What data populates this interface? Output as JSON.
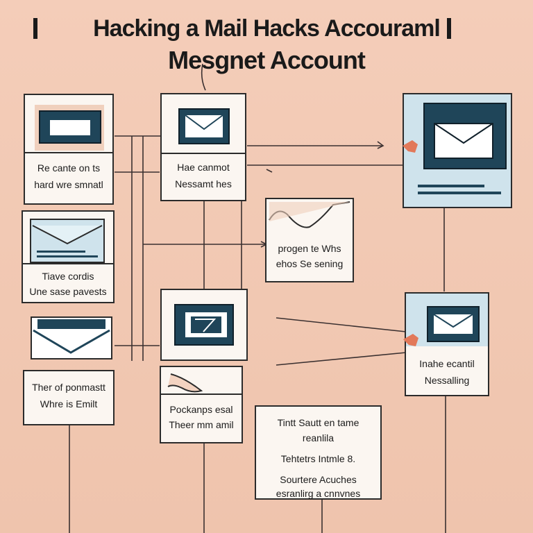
{
  "title": {
    "line1": "Hacking a Mail Hacks Accouraml",
    "line2": "Mesgnet Account"
  },
  "labels": {
    "card1": [
      "Re cante on ts",
      "hard wre smnatl"
    ],
    "card2": [
      "Hae canmot",
      "Nessamt hes"
    ],
    "card3": [
      "Tiave cordis",
      "Une sase pavests"
    ],
    "card4": [
      "Ther of ponmastt",
      "Whre is Emilt"
    ],
    "card5": [
      "Pockanps esal",
      "Theer mm amil"
    ],
    "card6": [
      "Tintt Sautt en tame",
      "reanlila"
    ],
    "card6b": [
      "Tehtetrs Intmle 8.",
      "Sourtere Acuches",
      "esranlirg a cnnvnes"
    ],
    "card7": [
      "progen te Whs",
      "ehos Se sening"
    ],
    "card8": [
      "Inahe ecantil",
      "Nessalling"
    ]
  },
  "colors": {
    "background": "#f2c9b4",
    "envelope": "#1f4559",
    "panel_light": "#cfe3ec",
    "accent_hand": "#e2795a",
    "line": "#3a3030"
  },
  "icons": [
    "envelope-icon",
    "hand-icon",
    "open-envelope-icon"
  ]
}
